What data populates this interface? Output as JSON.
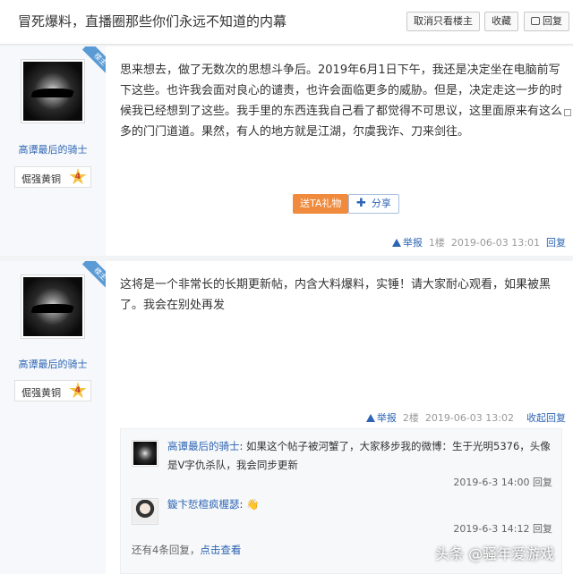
{
  "header": {
    "title": "冒死爆料，直播圈那些你们永远不知道的内幕",
    "buttons": {
      "only_op": "取消只看楼主",
      "favorite": "收藏",
      "reply": "回复"
    }
  },
  "posts": [
    {
      "author": "高谭最后的骑士",
      "role_badge": "楼主",
      "level_name": "倔强黄铜",
      "level_num": "4",
      "content": "思来想去，做了无数次的思想斗争后。2019年6月1日下午，我还是决定坐在电脑前写下这些。也许我会面对良心的谴责，也许会面临更多的威胁。但是，决定走这一步的时候我已经想到了这些。我手里的东西连我自己看了都觉得不可思议，这里面原来有这么多的门门道道。果然，有人的地方就是江湖，尔虞我诈、刀来剑往。",
      "gift_label": "送TA礼物",
      "share_label": "分享",
      "report_label": "举报",
      "floor": "1楼",
      "time": "2019-06-03 13:01",
      "reply_label": "回复"
    },
    {
      "author": "高谭最后的骑士",
      "role_badge": "楼主",
      "level_name": "倔强黄铜",
      "level_num": "4",
      "content": "这将是一个非常长的长期更新帖，内含大料爆料，实锤！请大家耐心观看，如果被黑了。我会在别处再发",
      "report_label": "举报",
      "floor": "2楼",
      "time": "2019-06-03 13:02",
      "collapse_label": "收起回复",
      "replies": [
        {
          "author": "高谭最后的骑士",
          "text": "如果这个帖子被河蟹了，大家移步我的微博：生于光明5376，头像是V字仇杀队，我会同步更新",
          "time": "2019-6-3 14:00",
          "reply_label": "回复"
        },
        {
          "author": "鏇卞悊楦疯楃瑟",
          "text": "👋",
          "time": "2019-6-3 14:12",
          "reply_label": "回复"
        }
      ],
      "more_text": "还有4条回复，",
      "more_link": "点击查看"
    }
  ],
  "watermark": "头条 @骚年爱游戏"
}
